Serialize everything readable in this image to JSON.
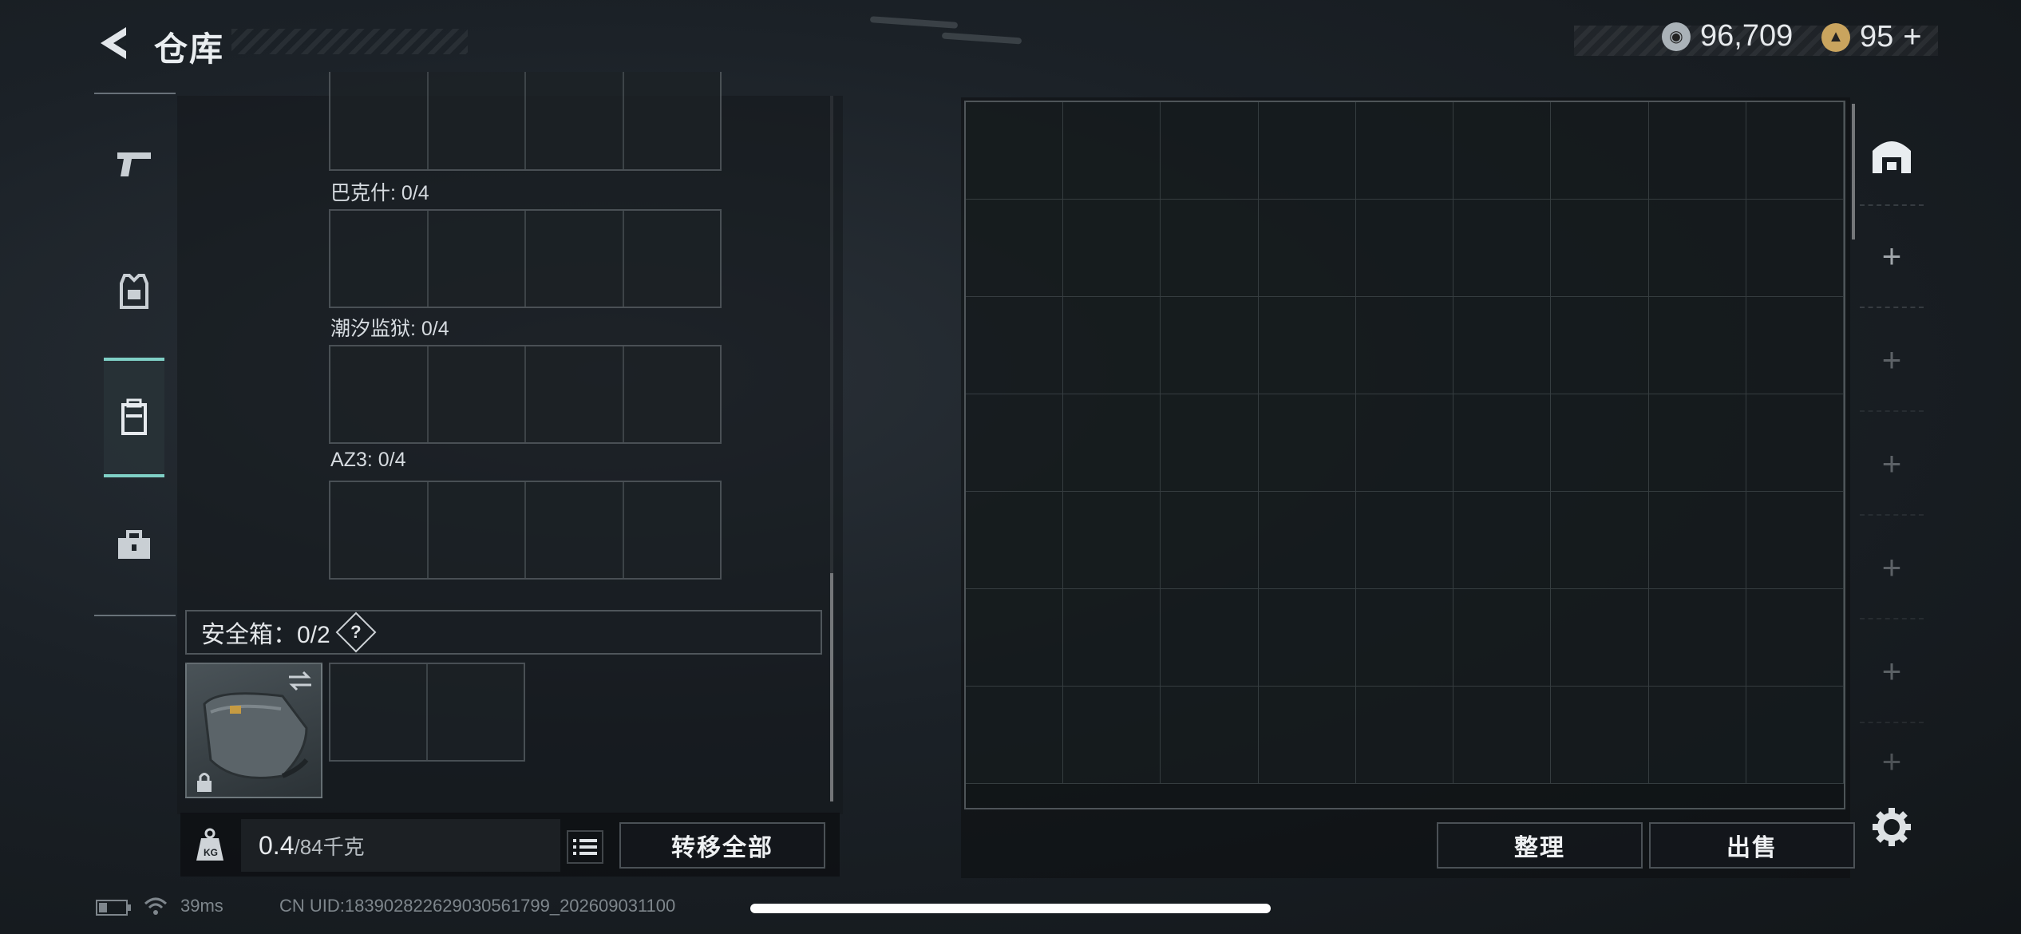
{
  "header": {
    "title": "仓库"
  },
  "currency": [
    {
      "icon": "silver-coin-icon",
      "value": "96,709",
      "color": "#b9c0c6"
    },
    {
      "icon": "gold-coin-icon",
      "value": "95",
      "suffix": "+",
      "color": "#d4b06a"
    }
  ],
  "nav": [
    {
      "icon": "pistol-icon",
      "active": false
    },
    {
      "icon": "vest-icon",
      "active": false
    },
    {
      "icon": "backpack-icon",
      "active": true
    },
    {
      "icon": "toolbox-icon",
      "active": false
    }
  ],
  "loadout_groups": [
    {
      "label": "巴克什: 0/4"
    },
    {
      "label": "潮汐监狱: 0/4"
    },
    {
      "label": "AZ3: 0/4"
    }
  ],
  "safebox": {
    "label": "安全箱：0/2",
    "help": "?"
  },
  "weight": {
    "current": "0.4",
    "max": "/84千克"
  },
  "buttons": {
    "transfer_all": "转移全部",
    "sort": "整理",
    "sell": "出售"
  },
  "right_tabs": [
    {
      "icon": "storage-tab-icon"
    },
    {
      "icon": "add-tab-icon",
      "label": "+"
    },
    {
      "icon": "add-tab-icon",
      "label": "+"
    },
    {
      "icon": "add-tab-icon",
      "label": "+"
    },
    {
      "icon": "add-tab-icon",
      "label": "+"
    },
    {
      "icon": "add-tab-icon",
      "label": "+"
    },
    {
      "icon": "add-tab-icon",
      "label": "+"
    }
  ],
  "status": {
    "ping": "39ms",
    "uid": "CN UID:1839028226290305617​99_202609031100"
  },
  "accent": "#7fd0c6"
}
